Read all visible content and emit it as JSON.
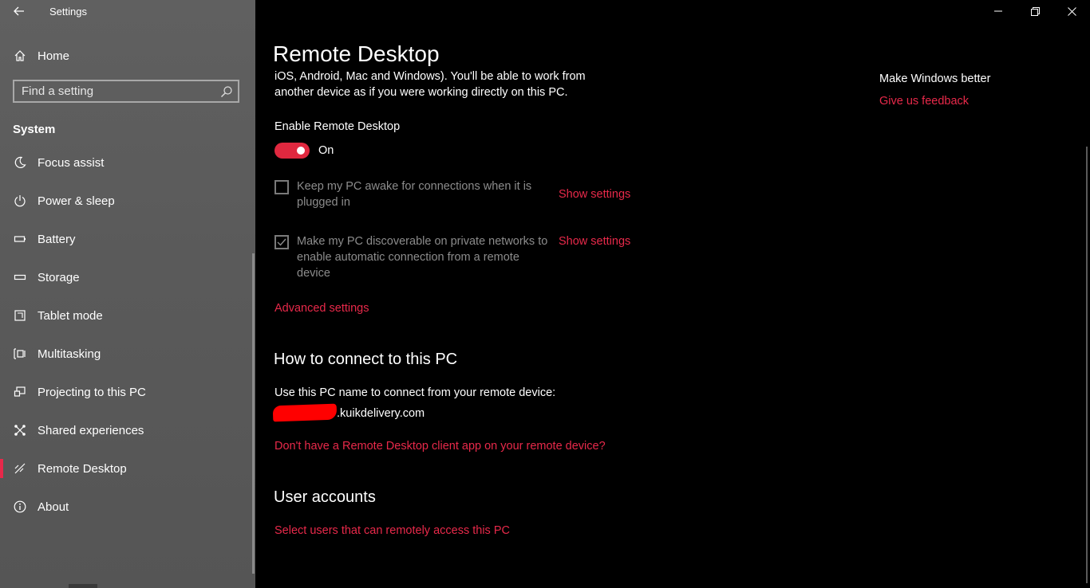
{
  "window": {
    "title": "Settings",
    "controls": {
      "minimize": "minimize",
      "restore": "restore",
      "close": "close"
    }
  },
  "sidebar": {
    "home_label": "Home",
    "search": {
      "placeholder": "Find a setting",
      "value": ""
    },
    "section_title": "System",
    "items": [
      {
        "label": "Focus assist",
        "icon": "moon-icon"
      },
      {
        "label": "Power & sleep",
        "icon": "power-icon"
      },
      {
        "label": "Battery",
        "icon": "battery-icon"
      },
      {
        "label": "Storage",
        "icon": "storage-icon"
      },
      {
        "label": "Tablet mode",
        "icon": "tablet-icon"
      },
      {
        "label": "Multitasking",
        "icon": "multitasking-icon"
      },
      {
        "label": "Projecting to this PC",
        "icon": "projecting-icon"
      },
      {
        "label": "Shared experiences",
        "icon": "shared-experiences-icon"
      },
      {
        "label": "Remote Desktop",
        "icon": "remote-desktop-icon",
        "selected": true
      },
      {
        "label": "About",
        "icon": "info-icon"
      }
    ]
  },
  "main": {
    "title": "Remote Desktop",
    "intro": "iOS, Android, Mac and Windows). You'll be able to work from another device as if you were working directly on this PC.",
    "enable_label": "Enable Remote Desktop",
    "toggle": {
      "state": "On",
      "on": true
    },
    "options": [
      {
        "label": "Keep my PC awake for connections when it is plugged in",
        "checked": false,
        "link": "Show settings"
      },
      {
        "label": "Make my PC discoverable on private networks to enable automatic connection from a remote device",
        "checked": true,
        "link": "Show settings"
      }
    ],
    "advanced_link": "Advanced settings",
    "connect": {
      "heading": "How to connect to this PC",
      "label": "Use this PC name to connect from your remote device:",
      "pc_name_suffix": ".kuikdelivery.com",
      "client_link": "Don't have a Remote Desktop client app on your remote device?"
    },
    "accounts": {
      "heading": "User accounts",
      "link": "Select users that can remotely access this PC"
    }
  },
  "aside": {
    "title": "Make Windows better",
    "feedback_link": "Give us feedback"
  },
  "colors": {
    "accent": "#e8294a",
    "sidebar_bg": "#5a5a5a",
    "main_bg": "#000000",
    "dim_text": "#8c8c8c"
  }
}
